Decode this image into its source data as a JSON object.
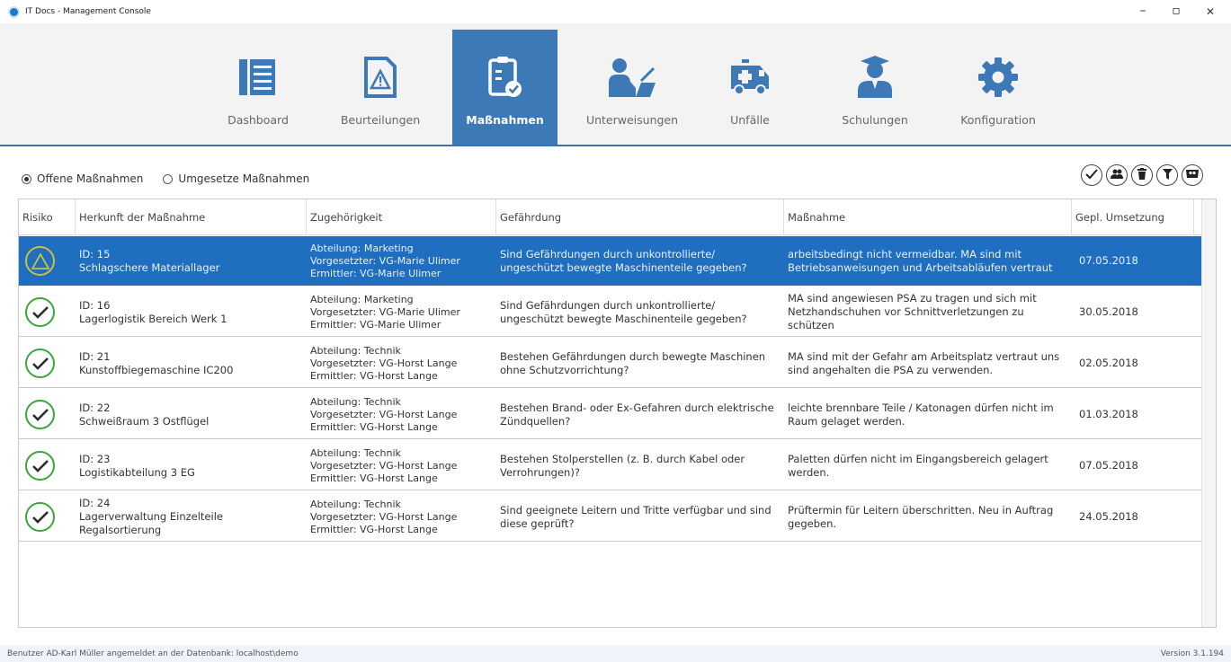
{
  "window": {
    "title": "IT Docs - Management Console",
    "minimize": "–",
    "maximize": "▫",
    "close": "✕"
  },
  "nav": {
    "items": [
      {
        "label": "Dashboard",
        "icon": "dashboard-icon",
        "active": false
      },
      {
        "label": "Beurteilungen",
        "icon": "warning-document-icon",
        "active": false
      },
      {
        "label": "Maßnahmen",
        "icon": "clipboard-check-icon",
        "active": true
      },
      {
        "label": "Unterweisungen",
        "icon": "person-writing-icon",
        "active": false
      },
      {
        "label": "Unfälle",
        "icon": "ambulance-icon",
        "active": false
      },
      {
        "label": "Schulungen",
        "icon": "graduate-icon",
        "active": false
      },
      {
        "label": "Konfiguration",
        "icon": "gear-icon",
        "active": false
      }
    ],
    "active_color": "#3c79b6",
    "icon_color": "#3c79b6"
  },
  "filters": {
    "open_label": "Offene Maßnahmen",
    "open_selected": true,
    "done_label": "Umgesetze Maßnahmen",
    "done_selected": false
  },
  "actions": [
    "check-icon",
    "group-icon",
    "trash-icon",
    "filter-icon",
    "view-icon"
  ],
  "table": {
    "headers": {
      "risk": "Risiko",
      "origin": "Herkunft der Maßnahme",
      "belonging": "Zugehörigkeit",
      "hazard": "Gefährdung",
      "measure": "Maßnahme",
      "planned": "Gepl. Umsetzung"
    },
    "rows": [
      {
        "risk_icon": "warning-icon",
        "id": "ID: 15",
        "origin": "Schlagschere Materiallager",
        "origin2": "",
        "dept": "Abteilung: Marketing",
        "supervisor": "Vorgesetzter: VG-Marie Ulimer",
        "reporter": "Ermittler: VG-Marie Ulimer",
        "hazard": "Sind Gefährdungen durch unkontrollierte/ ungeschützt bewegte Maschinenteile gegeben?",
        "measure": "arbeitsbedingt nicht vermeidbar. MA sind mit Betriebsanweisungen und Arbeitsabläufen vertraut",
        "date": "07.05.2018"
      },
      {
        "risk_icon": "check-icon",
        "id": "ID: 16",
        "origin": "Lagerlogistik Bereich Werk 1",
        "origin2": "",
        "dept": "Abteilung: Marketing",
        "supervisor": "Vorgesetzter: VG-Marie Ulimer",
        "reporter": "Ermittler: VG-Marie Ulimer",
        "hazard": "Sind Gefährdungen durch unkontrollierte/ ungeschützt bewegte Maschinenteile gegeben?",
        "measure": "MA sind angewiesen PSA zu tragen und sich mit Netzhandschuhen vor Schnittverletzungen zu schützen",
        "date": "30.05.2018"
      },
      {
        "risk_icon": "check-icon",
        "id": "ID: 21",
        "origin": "Kunstoffbiegemaschine IC200",
        "origin2": "",
        "dept": "Abteilung: Technik",
        "supervisor": "Vorgesetzter: VG-Horst Lange",
        "reporter": "Ermittler: VG-Horst Lange",
        "hazard": "Bestehen Gefährdungen durch bewegte Maschinen ohne Schutzvorrichtung?",
        "measure": "MA sind mit der Gefahr am Arbeitsplatz vertraut uns sind angehalten die PSA zu verwenden.",
        "date": "02.05.2018"
      },
      {
        "risk_icon": "check-icon",
        "id": "ID: 22",
        "origin": "Schweißraum 3 Ostflügel",
        "origin2": "",
        "dept": "Abteilung: Technik",
        "supervisor": "Vorgesetzter: VG-Horst Lange",
        "reporter": "Ermittler: VG-Horst Lange",
        "hazard": "Bestehen Brand- oder Ex-Gefahren durch elektrische Zündquellen?",
        "measure": "leichte brennbare Teile / Katonagen dürfen nicht im Raum gelaget werden.",
        "date": "01.03.2018"
      },
      {
        "risk_icon": "check-icon",
        "id": "ID: 23",
        "origin": "Logistikabteilung 3 EG",
        "origin2": "",
        "dept": "Abteilung: Technik",
        "supervisor": "Vorgesetzter: VG-Horst Lange",
        "reporter": "Ermittler: VG-Horst Lange",
        "hazard": "Bestehen Stolperstellen (z. B. durch Kabel oder Verrohrungen)?",
        "measure": "Paletten dürfen nicht im Eingangsbereich gelagert werden.",
        "date": "07.05.2018"
      },
      {
        "risk_icon": "check-icon",
        "id": "ID: 24",
        "origin": "Lagerverwaltung Einzelteile",
        "origin2": "Regalsortierung",
        "dept": "Abteilung: Technik",
        "supervisor": "Vorgesetzter: VG-Horst Lange",
        "reporter": "Ermittler: VG-Horst Lange",
        "hazard": "Sind geeignete Leitern und Tritte verfügbar und sind diese geprüft?",
        "measure": "Prüftermin für Leitern überschritten. Neu in Auftrag gegeben.",
        "date": "24.05.2018"
      }
    ]
  },
  "status": {
    "left": "Benutzer AD-Karl Müller angemeldet an der Datenbank: localhost\\demo",
    "right": "Version 3.1.194"
  }
}
